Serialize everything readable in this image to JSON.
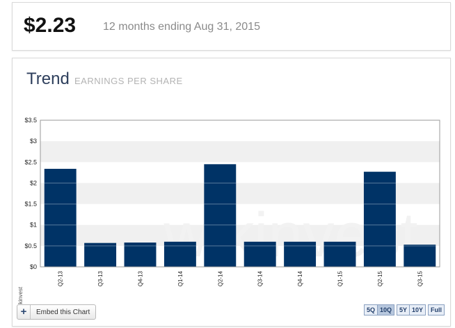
{
  "summary": {
    "value": "$2.23",
    "period": "12 months ending Aug 31, 2015"
  },
  "trend": {
    "title": "Trend",
    "subtitle": "EARNINGS PER SHARE",
    "watermark": "wikinvest",
    "embed_label": "Embed this Chart",
    "ranges": [
      "5Q",
      "10Q",
      "5Y",
      "10Y",
      "Full"
    ],
    "active_range": "10Q"
  },
  "colors": {
    "bar": "#003366",
    "band": "#f0f0f0",
    "axis": "#999999"
  },
  "chart_data": {
    "type": "bar",
    "categories": [
      "Q2-13",
      "Q3-13",
      "Q4-13",
      "Q1-14",
      "Q2-14",
      "Q3-14",
      "Q4-14",
      "Q1-15",
      "Q2-15",
      "Q3-15"
    ],
    "values": [
      2.34,
      0.57,
      0.58,
      0.6,
      2.45,
      0.6,
      0.6,
      0.6,
      2.27,
      0.53
    ],
    "ylim": [
      0,
      3.5
    ],
    "yticks": [
      "$0",
      "$0.5",
      "$1",
      "$1.5",
      "$2",
      "$2.5",
      "$3",
      "$3.5"
    ],
    "xlabel": "",
    "ylabel": "",
    "grid": "alternating horizontal bands"
  }
}
